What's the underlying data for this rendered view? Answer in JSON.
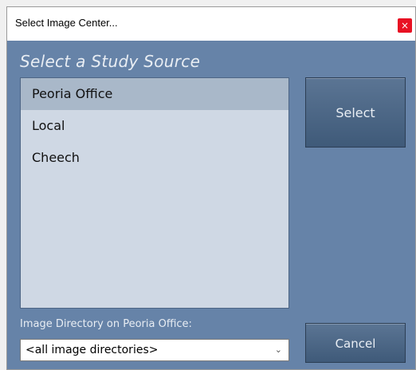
{
  "window": {
    "title": "Select Image Center...",
    "close_glyph": "×"
  },
  "heading": "Select a Study Source",
  "sources": [
    {
      "label": "Peoria Office",
      "selected": true
    },
    {
      "label": "Local",
      "selected": false
    },
    {
      "label": "Cheech",
      "selected": false
    }
  ],
  "buttons": {
    "select": "Select",
    "cancel": "Cancel"
  },
  "directory": {
    "label": "Image Directory on Peoria Office:",
    "selected_value": "<all image directories>",
    "chevron_glyph": "⌄"
  },
  "colors": {
    "panel": "#6683a8",
    "list_bg": "#cfd8e4",
    "list_selected": "#a9b8c9",
    "close": "#e81123"
  },
  "icons": [
    "close-icon",
    "chevron-down-icon"
  ]
}
